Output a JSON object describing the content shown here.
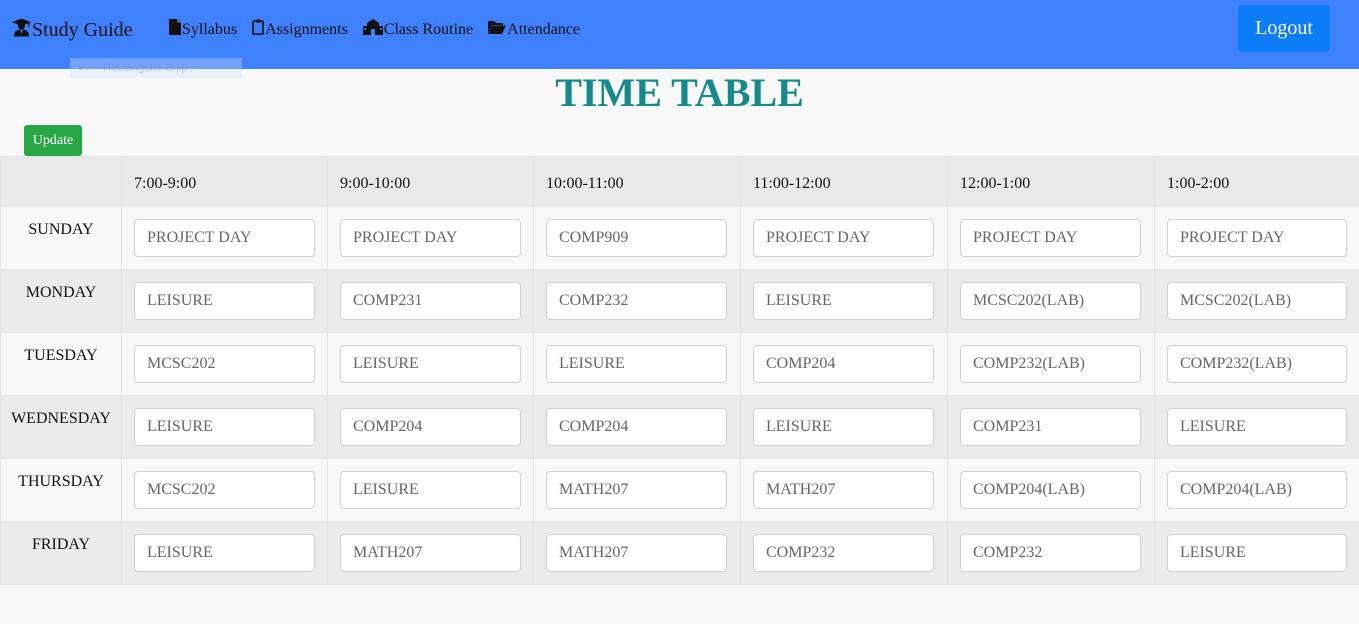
{
  "navbar": {
    "brand": "Study Guide",
    "brand_icon": "graduate-icon",
    "links": [
      {
        "label": "Syllabus",
        "icon": "file-icon"
      },
      {
        "label": "Assignments",
        "icon": "clipboard-icon"
      },
      {
        "label": "Class Routine",
        "icon": "school-icon"
      },
      {
        "label": "Attendance",
        "icon": "folder-open-icon"
      }
    ],
    "logout_label": "Logout",
    "background_color": "#3f80fd",
    "logout_color": "#0d7cf7"
  },
  "ghost_tooltip": "Rectangular Snip",
  "page_title": "TIME TABLE",
  "title_color": "#148a8a",
  "update_label": "Update",
  "update_color": "#28a745",
  "timetable": {
    "time_slots": [
      "7:00-9:00",
      "9:00-10:00",
      "10:00-11:00",
      "11:00-12:00",
      "12:00-1:00",
      "1:00-2:00"
    ],
    "rows": [
      {
        "day": "SUNDAY",
        "slots": [
          "PROJECT DAY",
          "PROJECT DAY",
          "COMP909",
          "PROJECT DAY",
          "PROJECT DAY",
          "PROJECT DAY"
        ]
      },
      {
        "day": "MONDAY",
        "slots": [
          "LEISURE",
          "COMP231",
          "COMP232",
          "LEISURE",
          "MCSC202(LAB)",
          "MCSC202(LAB)"
        ]
      },
      {
        "day": "TUESDAY",
        "slots": [
          "MCSC202",
          "LEISURE",
          "LEISURE",
          "COMP204",
          "COMP232(LAB)",
          "COMP232(LAB)"
        ]
      },
      {
        "day": "WEDNESDAY",
        "slots": [
          "LEISURE",
          "COMP204",
          "COMP204",
          "LEISURE",
          "COMP231",
          "LEISURE"
        ]
      },
      {
        "day": "THURSDAY",
        "slots": [
          "MCSC202",
          "LEISURE",
          "MATH207",
          "MATH207",
          "COMP204(LAB)",
          "COMP204(LAB)"
        ]
      },
      {
        "day": "FRIDAY",
        "slots": [
          "LEISURE",
          "MATH207",
          "MATH207",
          "COMP232",
          "COMP232",
          "LEISURE"
        ]
      }
    ]
  }
}
